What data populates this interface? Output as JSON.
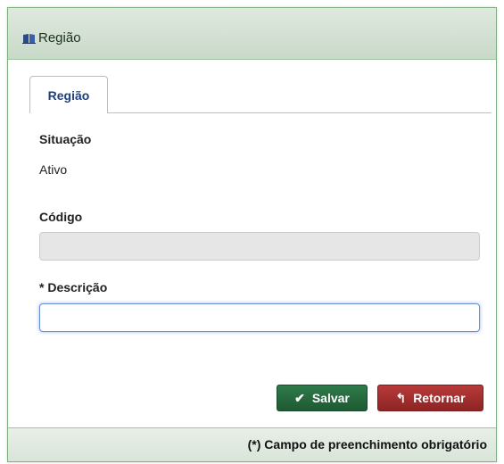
{
  "window": {
    "title": "Região",
    "icon": "book-icon"
  },
  "tabs": [
    {
      "label": "Região",
      "active": true
    }
  ],
  "form": {
    "situacao_label": "Situação",
    "situacao_value": "Ativo",
    "codigo_label": "Código",
    "codigo_value": "",
    "descricao_label": "* Descrição",
    "descricao_value": ""
  },
  "buttons": {
    "save_label": "Salvar",
    "save_icon": "check-icon",
    "return_label": "Retornar",
    "return_icon": "return-arrow-icon"
  },
  "footer": {
    "note": "(*) Campo de preenchimento obrigatório"
  },
  "colors": {
    "save": "#1e5a32",
    "return": "#8e2424",
    "tab_text": "#1f3f7f",
    "frame_border": "#7fae7f"
  }
}
